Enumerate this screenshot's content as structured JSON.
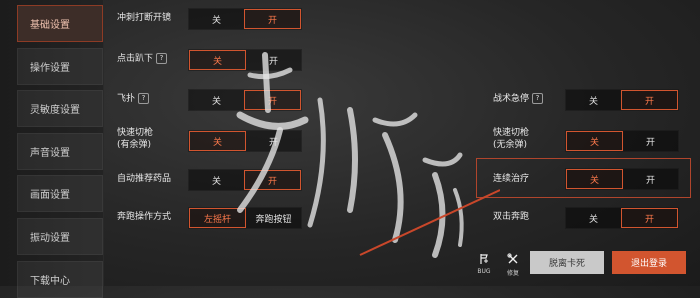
{
  "sidebar": {
    "items": [
      {
        "label": "基础设置",
        "active": true
      },
      {
        "label": "操作设置",
        "active": false
      },
      {
        "label": "灵敏度设置",
        "active": false
      },
      {
        "label": "声音设置",
        "active": false
      },
      {
        "label": "画面设置",
        "active": false
      },
      {
        "label": "振动设置",
        "active": false
      },
      {
        "label": "下载中心",
        "active": false
      }
    ]
  },
  "settings": {
    "punch_door": {
      "label": "冲刺打断开镜",
      "options": [
        "关",
        "开"
      ],
      "selected": "开"
    },
    "tap_lie": {
      "label": "点击趴下",
      "options": [
        "关",
        "开"
      ],
      "selected": "关"
    },
    "fly": {
      "label": "飞扑",
      "options": [
        "关",
        "开"
      ],
      "selected": "开"
    },
    "quick_switch_bullets": {
      "label_line1": "快速切枪",
      "label_line2": "(有余弹)",
      "options": [
        "关",
        "开"
      ],
      "selected": "关"
    },
    "auto_recommend_meds": {
      "label": "自动推荐药品",
      "options": [
        "关",
        "开"
      ],
      "selected": "开"
    },
    "run_mode": {
      "label": "奔跑操作方式",
      "options": [
        "左摇杆",
        "奔跑按钮"
      ],
      "selected": "左摇杆"
    },
    "tactical_lie": {
      "label": "战术急停",
      "options": [
        "关",
        "开"
      ],
      "selected": "开"
    },
    "quick_switch_nobullets": {
      "label_line1": "快速切枪",
      "label_line2": "(无余弹)",
      "options": [
        "关",
        "开"
      ],
      "selected": "关"
    },
    "continuous_heal": {
      "label": "连续治疗",
      "options": [
        "关",
        "开"
      ],
      "selected": "关"
    },
    "double_tap_run": {
      "label": "双击奔跑",
      "options": [
        "关",
        "开"
      ],
      "selected": "开"
    }
  },
  "help_glyph": "?",
  "footer": {
    "bug": {
      "icon": "bug-report-icon",
      "label": "BUG"
    },
    "repair": {
      "icon": "repair-tools-icon",
      "label": "修复"
    },
    "unstuck_label": "脱离卡死",
    "logout_label": "退出登录"
  },
  "colors": {
    "accent": "#d2552f",
    "active_text": "#ff7a4c",
    "sidebar_active_bg": "#3d2d28"
  }
}
